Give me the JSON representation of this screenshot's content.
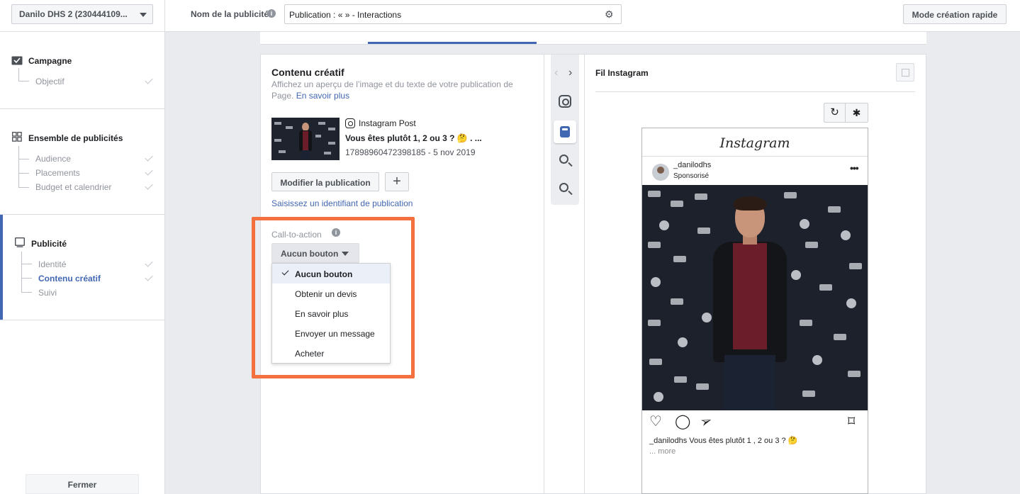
{
  "sidebar": {
    "account": "Danilo DHS 2 (230444109...",
    "campaign": {
      "title": "Campagne",
      "items": [
        {
          "label": "Objectif",
          "done": true
        }
      ]
    },
    "adset": {
      "title": "Ensemble de publicités",
      "items": [
        {
          "label": "Audience",
          "done": true
        },
        {
          "label": "Placements",
          "done": true
        },
        {
          "label": "Budget et calendrier",
          "done": true
        }
      ]
    },
    "ad": {
      "title": "Publicité",
      "items": [
        {
          "label": "Identité",
          "done": true
        },
        {
          "label": "Contenu créatif",
          "done": true,
          "active": true
        },
        {
          "label": "Suivi",
          "done": false
        }
      ]
    },
    "close_label": "Fermer"
  },
  "topbar": {
    "ad_name_label": "Nom de la publicité",
    "ad_name_value": "Publication : «  » - Interactions",
    "quick_create_label": "Mode création rapide"
  },
  "creative": {
    "title": "Contenu créatif",
    "description": "Affichez un aperçu de l’image et du texte de votre publication de Page.",
    "learn_more": "En savoir plus",
    "post_type": "Instagram Post",
    "post_title": "Vous êtes plutôt 1, 2 ou 3 ? 🤔  . ...",
    "post_meta": "17898960472398185 - 5 nov 2019",
    "edit_label": "Modifier la publication",
    "add_label": "+",
    "post_id_link": "Saisissez un identifiant de publication"
  },
  "cta": {
    "label": "Call-to-action",
    "selected": "Aucun bouton",
    "options": [
      "Aucun bouton",
      "Obtenir un devis",
      "En savoir plus",
      "Envoyer un message",
      "Acheter"
    ],
    "highlight_color": "#f4703f"
  },
  "preview": {
    "title": "Fil Instagram",
    "ig_logo": "Instagram",
    "username": "_danilodhs",
    "sponsored": "Sponsorisé",
    "caption": "_danilodhs Vous êtes plutôt 1 , 2 ou 3 ? 🤔",
    "more": "... more"
  },
  "colors": {
    "accent": "#4267b2",
    "sidebar_active_bar": "#4267b2"
  }
}
